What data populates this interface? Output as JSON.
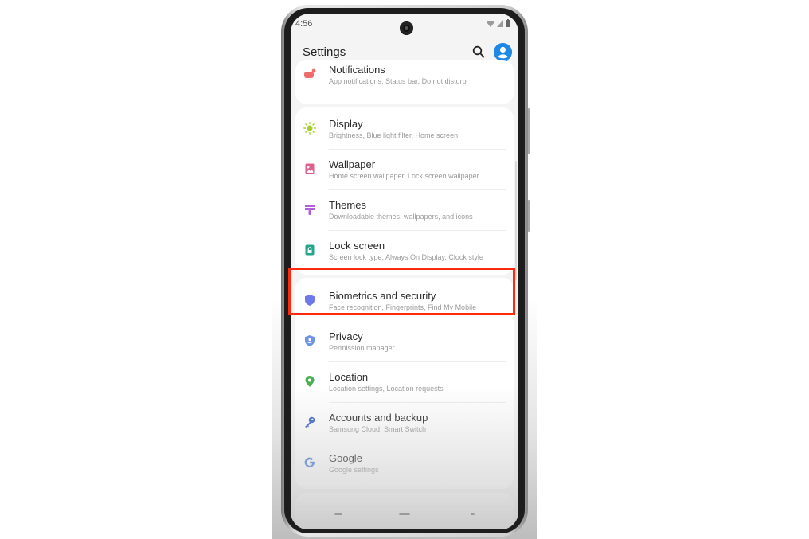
{
  "status_bar": {
    "time": "4:56",
    "icons": [
      "wifi-icon",
      "signal-icon",
      "battery-icon"
    ]
  },
  "app_bar": {
    "title": "Settings",
    "search_icon": "search-icon",
    "account_icon": "account-icon"
  },
  "colors": {
    "highlight": "#ff2a0d",
    "accent": "#1e88e5"
  },
  "items": [
    {
      "id": "notifications",
      "label": "Notifications",
      "sub": "App notifications, Status bar, Do not disturb",
      "icon": "notifications-icon",
      "color": "#f06b6b"
    },
    {
      "id": "display",
      "label": "Display",
      "sub": "Brightness, Blue light filter, Home screen",
      "icon": "sun-icon",
      "color": "#a4cf2a"
    },
    {
      "id": "wallpaper",
      "label": "Wallpaper",
      "sub": "Home screen wallpaper, Lock screen wallpaper",
      "icon": "wallpaper-icon",
      "color": "#e0608c"
    },
    {
      "id": "themes",
      "label": "Themes",
      "sub": "Downloadable themes, wallpapers, and icons",
      "icon": "brush-icon",
      "color": "#b260d9"
    },
    {
      "id": "lock-screen",
      "label": "Lock screen",
      "sub": "Screen lock type, Always On Display, Clock style",
      "icon": "lock-icon",
      "color": "#26a58a"
    },
    {
      "id": "biometrics",
      "label": "Biometrics and security",
      "sub": "Face recognition, Fingerprints, Find My Mobile",
      "icon": "shield-icon",
      "color": "#6f78e8",
      "highlighted": true
    },
    {
      "id": "privacy",
      "label": "Privacy",
      "sub": "Permission manager",
      "icon": "privacy-shield-icon",
      "color": "#6d94e8"
    },
    {
      "id": "location",
      "label": "Location",
      "sub": "Location settings, Location requests",
      "icon": "location-pin-icon",
      "color": "#4caf50"
    },
    {
      "id": "accounts",
      "label": "Accounts and backup",
      "sub": "Samsung Cloud, Smart Switch",
      "icon": "key-icon",
      "color": "#3f63c9"
    },
    {
      "id": "google",
      "label": "Google",
      "sub": "Google settings",
      "icon": "google-icon",
      "color": "#4a7fe0"
    }
  ]
}
